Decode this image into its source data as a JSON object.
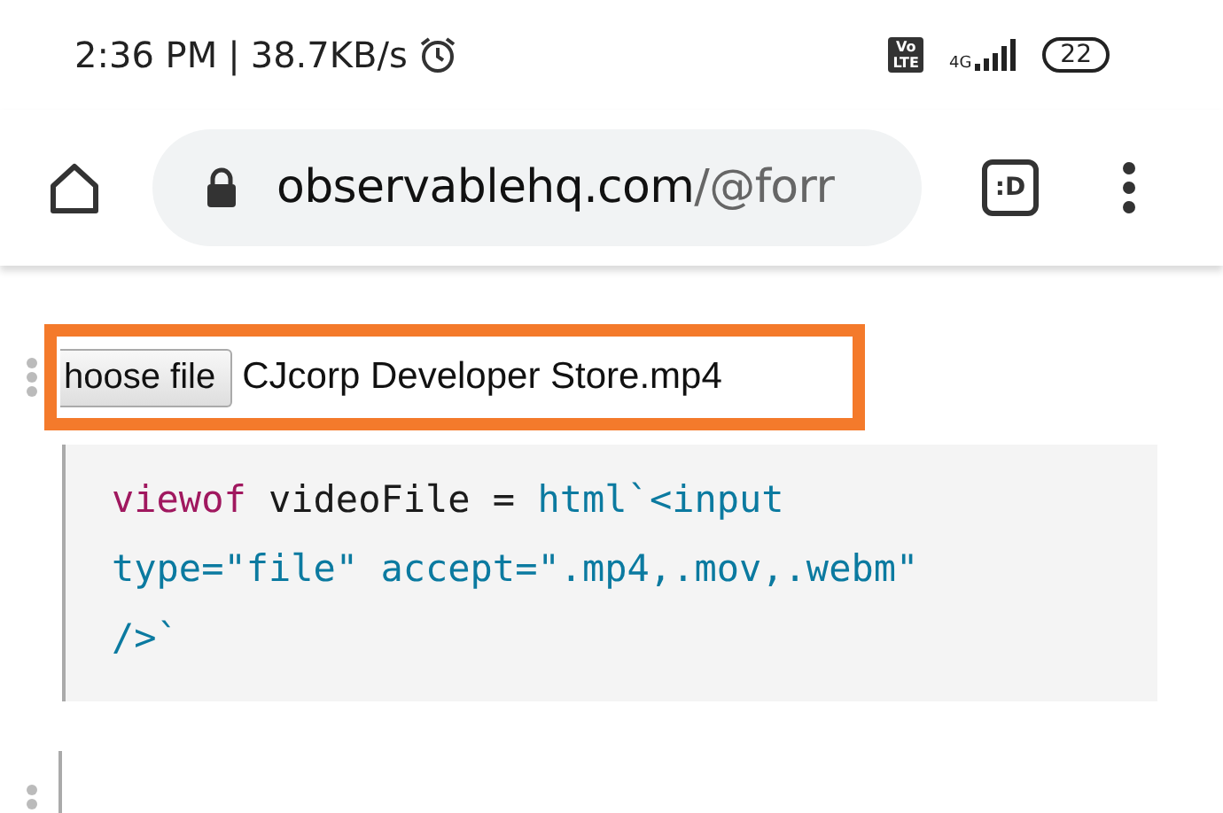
{
  "status_bar": {
    "time": "2:36 PM",
    "separator": "|",
    "speed": "38.7KB/s",
    "volte": [
      "Vo",
      "LTE"
    ],
    "network": "4G",
    "battery": "22"
  },
  "toolbar": {
    "url_host": "observablehq.com",
    "url_path": "/@forr",
    "tabs_label": ":D"
  },
  "file_input": {
    "button": "hoose file",
    "file_name": "CJcorp Developer Store.mp4"
  },
  "code_lines": [
    [
      {
        "text": "viewof",
        "kind": "keyword"
      },
      {
        "text": " videoFile = ",
        "kind": "plain"
      },
      {
        "text": "html`<input",
        "kind": "string"
      }
    ],
    [
      {
        "text": "type=\"file\" accept=\".mp4,.mov,.webm\"",
        "kind": "string"
      }
    ],
    [
      {
        "text": "/>`",
        "kind": "string"
      }
    ]
  ]
}
